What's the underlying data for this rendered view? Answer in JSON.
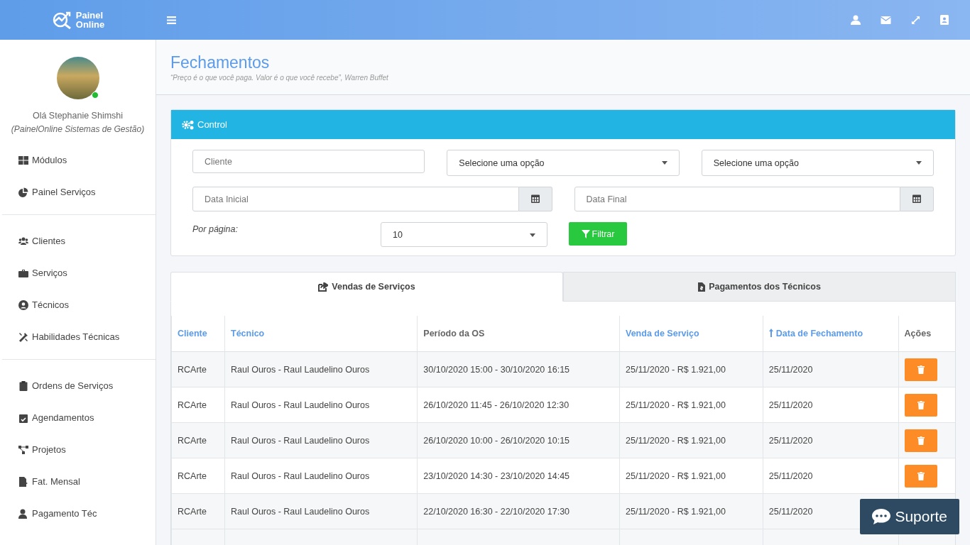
{
  "header": {
    "logo": [
      "Painel",
      "Online"
    ]
  },
  "profile": {
    "greeting": "Olá Stephanie Shimshi",
    "company": "(PainelOnline Sistemas de Gestão)",
    "online": true
  },
  "menu_groups": [
    [
      {
        "label": "Módulos"
      },
      {
        "label": "Painel Serviços"
      }
    ],
    [
      {
        "label": "Clientes"
      },
      {
        "label": "Serviços"
      },
      {
        "label": "Técnicos"
      },
      {
        "label": "Habilidades Técnicas"
      }
    ],
    [
      {
        "label": "Ordens de Serviços"
      },
      {
        "label": "Agendamentos"
      },
      {
        "label": "Projetos"
      },
      {
        "label": "Fat. Mensal"
      },
      {
        "label": "Pagamento Téc"
      }
    ]
  ],
  "page": {
    "title": "Fechamentos",
    "quote": "“Preço é o que você paga. Valor é o que você recebe”, Warren Buffet"
  },
  "control": {
    "title": "Control",
    "client_placeholder": "Cliente",
    "select_1": "Selecione uma opção",
    "select_2": "Selecione uma opção",
    "start_placeholder": "Data Inicial",
    "end_placeholder": "Data Final",
    "per_page_label": "Por página:",
    "per_page": "10",
    "filter_button": "Filtrar"
  },
  "tabs": [
    {
      "label": "Vendas de Serviços",
      "selected": true
    },
    {
      "label": "Pagamentos dos Técnicos",
      "selected": false
    }
  ],
  "table": {
    "columns": [
      {
        "label": "Cliente",
        "sortable": true,
        "sorted": false
      },
      {
        "label": "Técnico",
        "sortable": true,
        "sorted": false
      },
      {
        "label": "Período da OS",
        "sortable": false,
        "sorted": false
      },
      {
        "label": "Venda de Serviço",
        "sortable": true,
        "sorted": false
      },
      {
        "label": "Data de Fechamento",
        "sortable": true,
        "sorted": true
      },
      {
        "label": "Ações",
        "sortable": false,
        "sorted": false
      }
    ],
    "rows": [
      [
        "RCArte",
        "Raul Ouros - Raul Laudelino Ouros",
        "30/10/2020 15:00 - 30/10/2020 16:15",
        "25/11/2020 - R$ 1.921,00",
        "25/11/2020"
      ],
      [
        "RCArte",
        "Raul Ouros - Raul Laudelino Ouros",
        "26/10/2020 11:45 - 26/10/2020 12:30",
        "25/11/2020 - R$ 1.921,00",
        "25/11/2020"
      ],
      [
        "RCArte",
        "Raul Ouros - Raul Laudelino Ouros",
        "26/10/2020 10:00 - 26/10/2020 10:15",
        "25/11/2020 - R$ 1.921,00",
        "25/11/2020"
      ],
      [
        "RCArte",
        "Raul Ouros - Raul Laudelino Ouros",
        "23/10/2020 14:30 - 23/10/2020 14:45",
        "25/11/2020 - R$ 1.921,00",
        "25/11/2020"
      ],
      [
        "RCArte",
        "Raul Ouros - Raul Laudelino Ouros",
        "22/10/2020 16:30 - 22/10/2020 17:30",
        "25/11/2020 - R$ 1.921,00",
        "25/11/2020"
      ]
    ]
  },
  "support_button": "Suporte"
}
